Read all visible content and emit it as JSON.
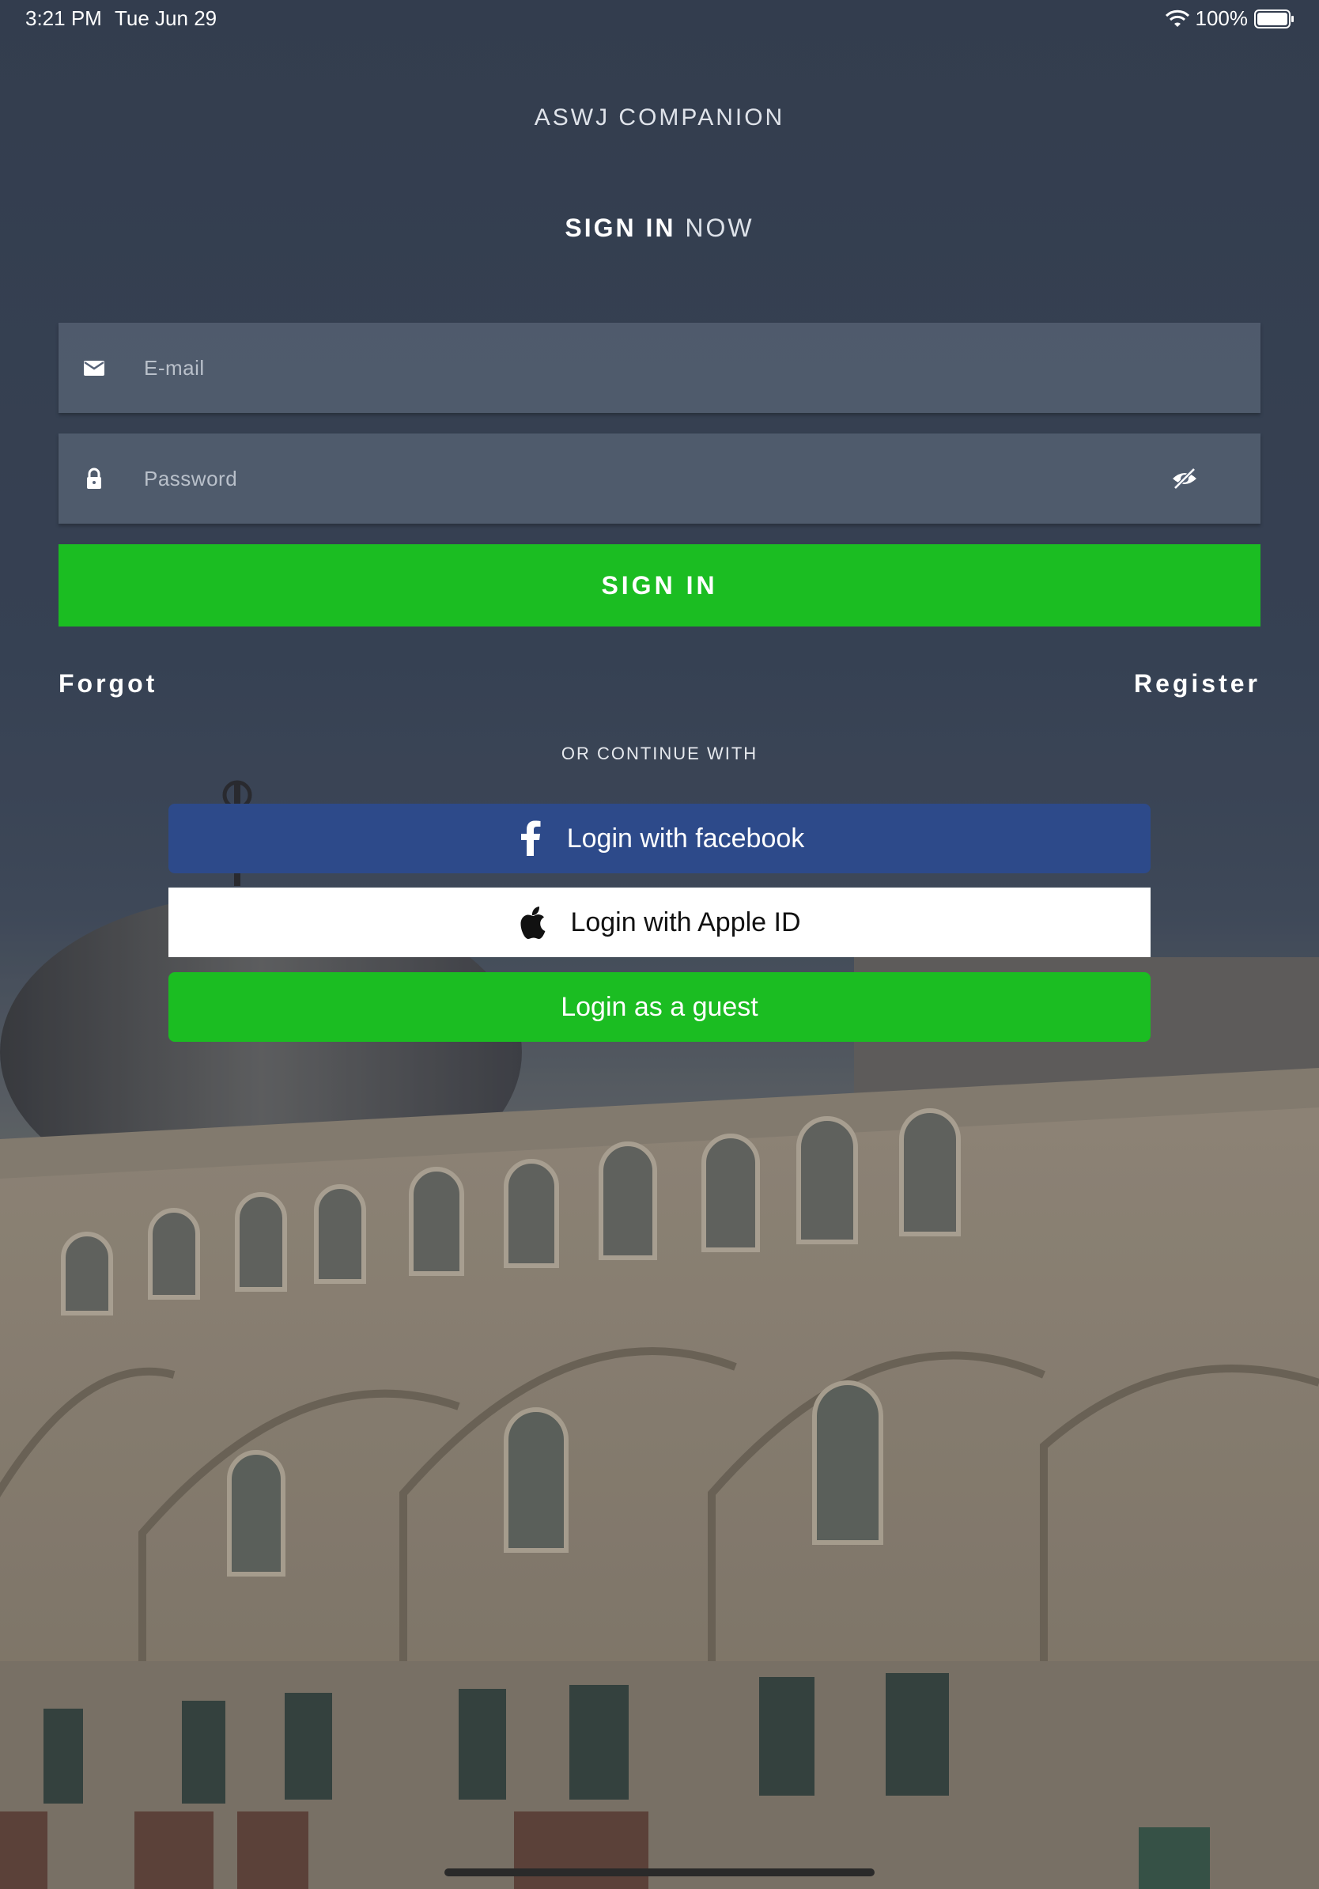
{
  "status_bar": {
    "time": "3:21 PM",
    "date": "Tue Jun 29",
    "battery": "100%",
    "wifi_icon": "wifi-icon",
    "battery_icon": "battery-icon"
  },
  "app_title": "ASWJ COMPANION",
  "heading": {
    "strong": "SIGN IN",
    "light": " NOW"
  },
  "form": {
    "email": {
      "placeholder": "E-mail",
      "value": "",
      "icon": "envelope-icon"
    },
    "password": {
      "placeholder": "Password",
      "value": "",
      "icon": "lock-icon",
      "toggle_icon": "eye-slash-icon"
    },
    "submit_label": "SIGN IN"
  },
  "links": {
    "forgot": "Forgot",
    "register": "Register"
  },
  "divider_text": "OR CONTINUE WITH",
  "social": {
    "facebook": {
      "label": "Login with facebook",
      "icon": "facebook-icon"
    },
    "apple": {
      "label": "Login with Apple ID",
      "icon": "apple-icon"
    },
    "guest": {
      "label": "Login as a guest"
    }
  },
  "colors": {
    "accent_green": "#1bbd22",
    "facebook_blue": "#2d4a8a",
    "apple_white": "#ffffff"
  }
}
